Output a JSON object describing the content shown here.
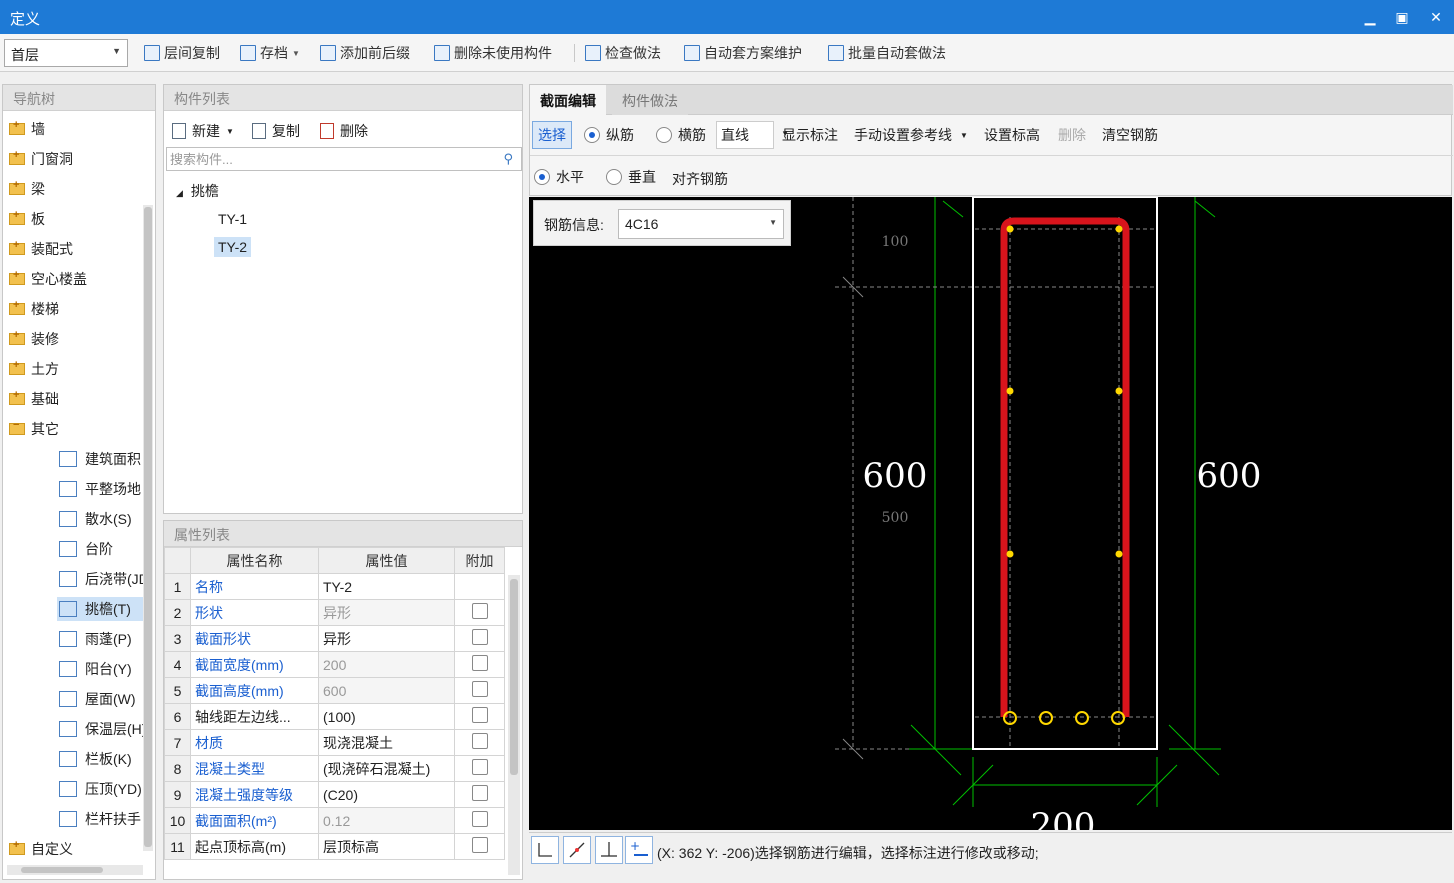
{
  "window": {
    "title": "定义"
  },
  "toolbar": {
    "floor": "首层",
    "buttons": [
      "层间复制",
      "存档",
      "添加前后缀",
      "删除未使用构件",
      "检查做法",
      "自动套方案维护",
      "批量自动套做法"
    ]
  },
  "nav": {
    "header": "导航树",
    "items": [
      "墙",
      "门窗洞",
      "梁",
      "板",
      "装配式",
      "空心楼盖",
      "楼梯",
      "装修",
      "土方",
      "基础",
      "其它"
    ],
    "sub_items": [
      "建筑面积",
      "平整场地",
      "散水(S)",
      "台阶",
      "后浇带(JD)",
      "挑檐(T)",
      "雨蓬(P)",
      "阳台(Y)",
      "屋面(W)",
      "保温层(H)",
      "栏板(K)",
      "压顶(YD)",
      "栏杆扶手"
    ],
    "last_item": "自定义"
  },
  "components": {
    "header": "构件列表",
    "new_label": "新建",
    "copy_label": "复制",
    "delete_label": "删除",
    "search_placeholder": "搜索构件...",
    "group": "挑檐",
    "items": [
      "TY-1",
      "TY-2"
    ]
  },
  "properties": {
    "header": "属性列表",
    "columns": [
      "属性名称",
      "属性值",
      "附加"
    ],
    "rows": [
      {
        "n": "1",
        "name": "名称",
        "value": "TY-2"
      },
      {
        "n": "2",
        "name": "形状",
        "value": "异形"
      },
      {
        "n": "3",
        "name": "截面形状",
        "value": "异形"
      },
      {
        "n": "4",
        "name": "截面宽度(mm)",
        "value": "200"
      },
      {
        "n": "5",
        "name": "截面高度(mm)",
        "value": "600"
      },
      {
        "n": "6",
        "name": "轴线距左边线...",
        "value": "(100)"
      },
      {
        "n": "7",
        "name": "材质",
        "value": "现浇混凝土"
      },
      {
        "n": "8",
        "name": "混凝土类型",
        "value": "(现浇碎石混凝土)"
      },
      {
        "n": "9",
        "name": "混凝土强度等级",
        "value": "(C20)"
      },
      {
        "n": "10",
        "name": "截面面积(m²)",
        "value": "0.12"
      },
      {
        "n": "11",
        "name": "起点顶标高(m)",
        "value": "层顶标高"
      }
    ]
  },
  "section": {
    "tabs": [
      "截面编辑",
      "构件做法"
    ],
    "select_label": "选择",
    "radio_long": "纵筋",
    "radio_trans": "横筋",
    "line_type": "直线",
    "show_marks": "显示标注",
    "manual_ref": "手动设置参考线",
    "set_elevation": "设置标高",
    "delete": "删除",
    "clear_rebar": "清空钢筋",
    "horizontal": "水平",
    "vertical": "垂直",
    "align_rebar": "对齐钢筋",
    "rebar_info_label": "钢筋信息:",
    "rebar_info_value": "4C16"
  },
  "drawing": {
    "dim_left": "600",
    "dim_right": "600",
    "dim_bottom": "200",
    "dim_100": "100",
    "dim_500": "500"
  },
  "status": {
    "text": "(X: 362 Y: -206)选择钢筋进行编辑，选择标注进行修改或移动;"
  }
}
